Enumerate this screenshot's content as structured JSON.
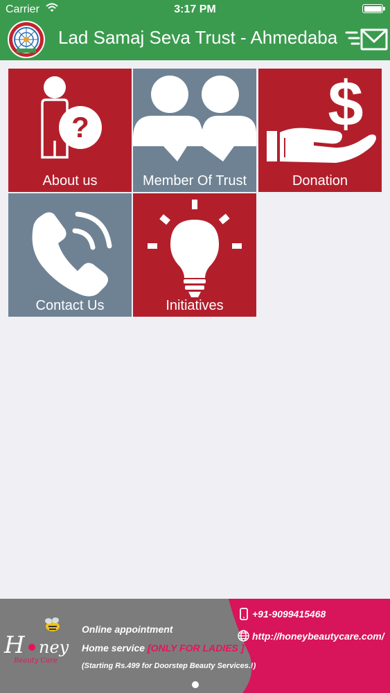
{
  "status_bar": {
    "carrier": "Carrier",
    "time": "3:17 PM"
  },
  "header": {
    "title": "Lad Samaj Seva Trust - Ahmedabad",
    "logo_icon": "trust-seal-logo",
    "action_icon": "compose-mail-icon",
    "color": "#3a9b4e"
  },
  "menu": {
    "tiles": [
      {
        "label": "About us",
        "icon": "person-question-icon",
        "color": "#b21f2b"
      },
      {
        "label": "Member Of Trust",
        "icon": "members-group-icon",
        "color": "#6e8293"
      },
      {
        "label": "Donation",
        "icon": "hand-dollar-icon",
        "color": "#b21f2b"
      },
      {
        "label": "Contact Us",
        "icon": "phone-icon",
        "color": "#6e8293"
      },
      {
        "label": "Initiatives",
        "icon": "lightbulb-icon",
        "color": "#b21f2b"
      }
    ]
  },
  "ad_banner": {
    "brand_icon": "honey-beauty-care-logo",
    "line1": "Online  appointment",
    "line2": "Home service ",
    "line2_highlight": "[ONLY FOR LADIES ]",
    "line3": "(Starting Rs.499 for Doorstep Beauty Services.!)",
    "phone": "+91-9099415468",
    "url": "http://honeybeautycare.com/",
    "accent": "#d8145a"
  }
}
